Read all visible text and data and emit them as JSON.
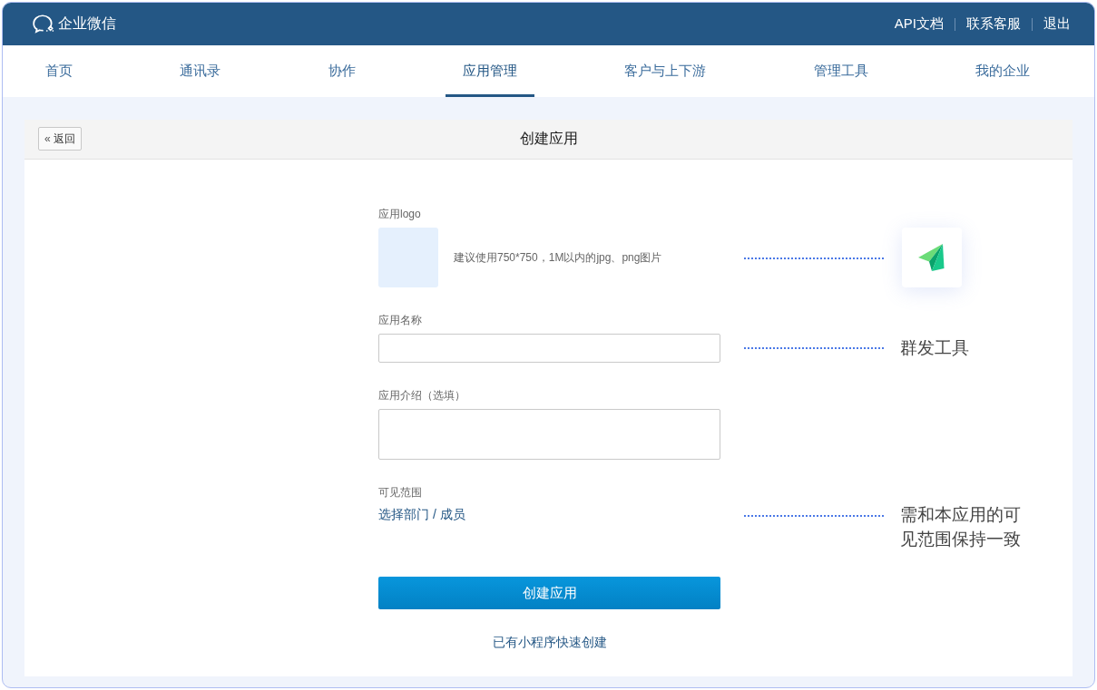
{
  "header": {
    "brand": "企业微信",
    "links": [
      "API文档",
      "联系客服",
      "退出"
    ]
  },
  "nav": [
    {
      "label": "首页",
      "selected": false
    },
    {
      "label": "通讯录",
      "selected": false
    },
    {
      "label": "协作",
      "selected": false
    },
    {
      "label": "应用管理",
      "selected": true
    },
    {
      "label": "客户与上下游",
      "selected": false
    },
    {
      "label": "管理工具",
      "selected": false
    },
    {
      "label": "我的企业",
      "selected": false
    }
  ],
  "card": {
    "back_button": {
      "icon": "«",
      "label": "返回"
    },
    "title": "创建应用"
  },
  "form": {
    "fields": [
      {
        "kind": "logo",
        "label": "应用logo",
        "hint": "建议使用750*750，1M以内的jpg、png图片",
        "annotation": {
          "kind": "app-icon"
        }
      },
      {
        "kind": "text-input",
        "label": "应用名称",
        "annotation": {
          "kind": "text",
          "text": "群发工具"
        }
      },
      {
        "kind": "textarea",
        "label": "应用介绍（选填）"
      },
      {
        "kind": "picker",
        "label": "可见范围",
        "link": "选择部门 / 成员",
        "annotation": {
          "kind": "text",
          "text": "需和本应用的可见范围保持一致"
        }
      }
    ],
    "submit": "创建应用",
    "alt_link": "已有小程序快速创建"
  }
}
